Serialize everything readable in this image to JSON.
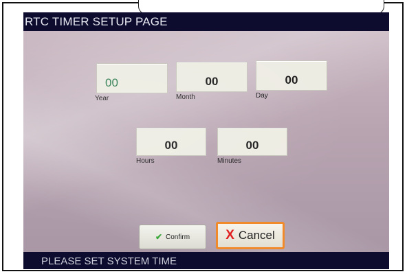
{
  "header": {
    "title": "RTC TIMER SETUP PAGE"
  },
  "fields": {
    "year": {
      "value": "00",
      "label": "Year"
    },
    "month": {
      "value": "00",
      "label": "Month"
    },
    "day": {
      "value": "00",
      "label": "Day"
    },
    "hours": {
      "value": "00",
      "label": "Hours"
    },
    "minutes": {
      "value": "00",
      "label": "Minutes"
    }
  },
  "buttons": {
    "confirm_label": "Confirm",
    "cancel_label": "Cancel"
  },
  "icons": {
    "confirm": "check-icon",
    "cancel": "x-icon"
  },
  "status": {
    "message": "PLEASE SET SYSTEM TIME"
  },
  "colors": {
    "cancel_border": "#f08a2a",
    "check": "#3aa83a",
    "x": "#e02020",
    "year_value": "#2e7d4f"
  }
}
